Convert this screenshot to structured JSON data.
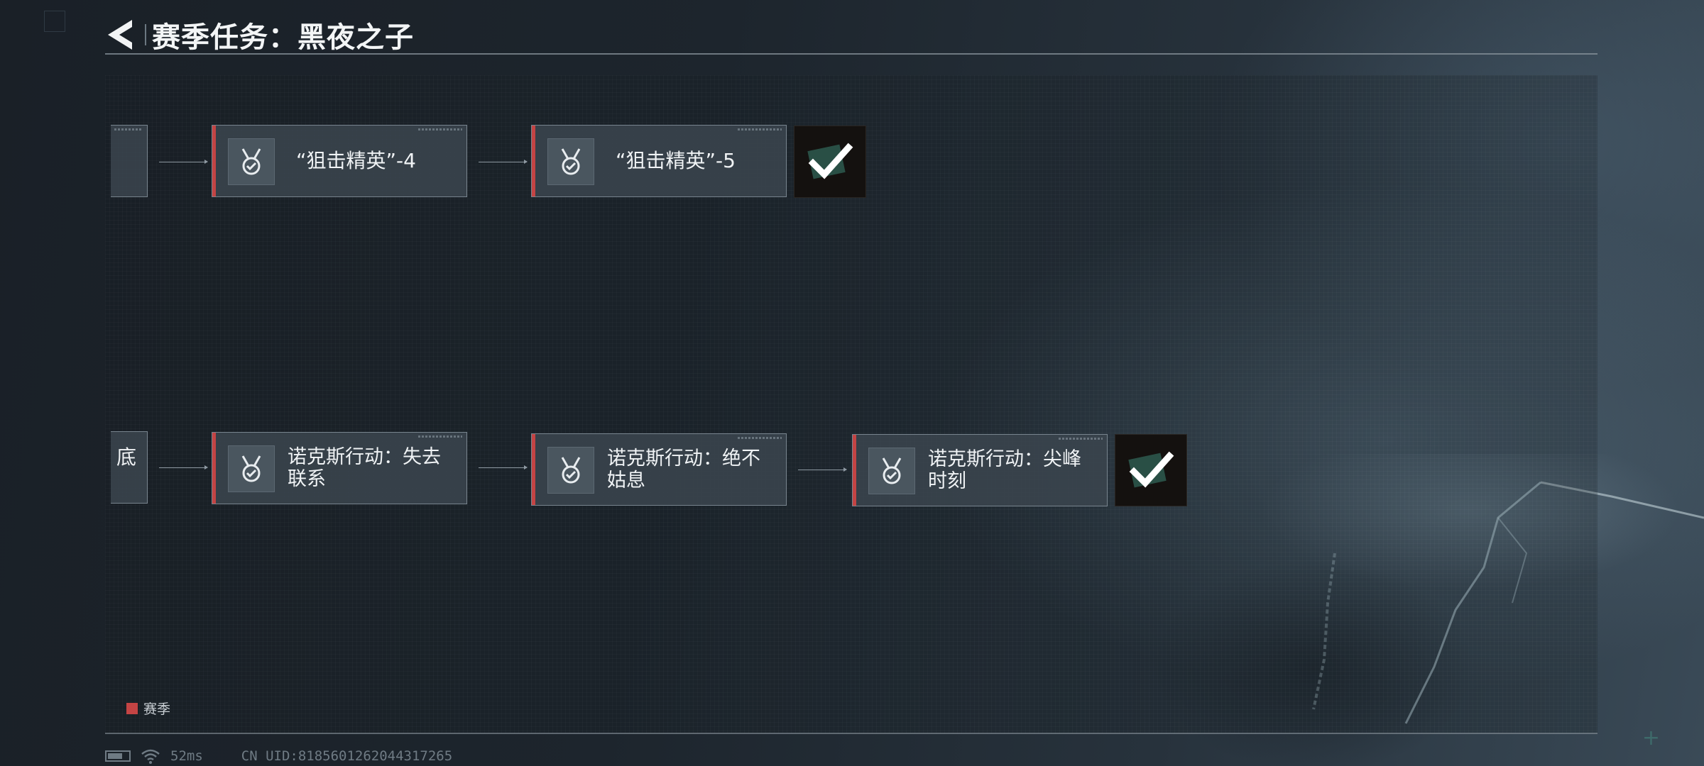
{
  "header": {
    "title": "赛季任务：黑夜之子",
    "back_icon": "back-arrow-icon"
  },
  "task_chains": [
    {
      "partial_label": "",
      "nodes": [
        {
          "label": "“狙击精英”-4",
          "icon": "medal-check-icon"
        },
        {
          "label": "“狙击精英”-5",
          "icon": "medal-check-icon"
        }
      ],
      "reward": {
        "icon": "completed-check-icon"
      }
    },
    {
      "partial_label": "底",
      "nodes": [
        {
          "label_line1": "诺克斯行动：失去",
          "label_line2": "联系",
          "icon": "medal-check-icon"
        },
        {
          "label_line1": "诺克斯行动：绝不",
          "label_line2": "姑息",
          "icon": "medal-check-icon"
        },
        {
          "label_line1": "诺克斯行动：尖峰",
          "label_line2": "时刻",
          "icon": "medal-check-icon"
        }
      ],
      "reward": {
        "icon": "completed-check-icon"
      }
    }
  ],
  "legend": {
    "label": "赛季",
    "color": "#c44444"
  },
  "status_bar": {
    "ping": "52ms",
    "uid": "CN UID:8185601262044317265"
  },
  "colors": {
    "accent": "#c44444",
    "node_bg": "#3a444d",
    "reward_bg": "#14110f"
  }
}
